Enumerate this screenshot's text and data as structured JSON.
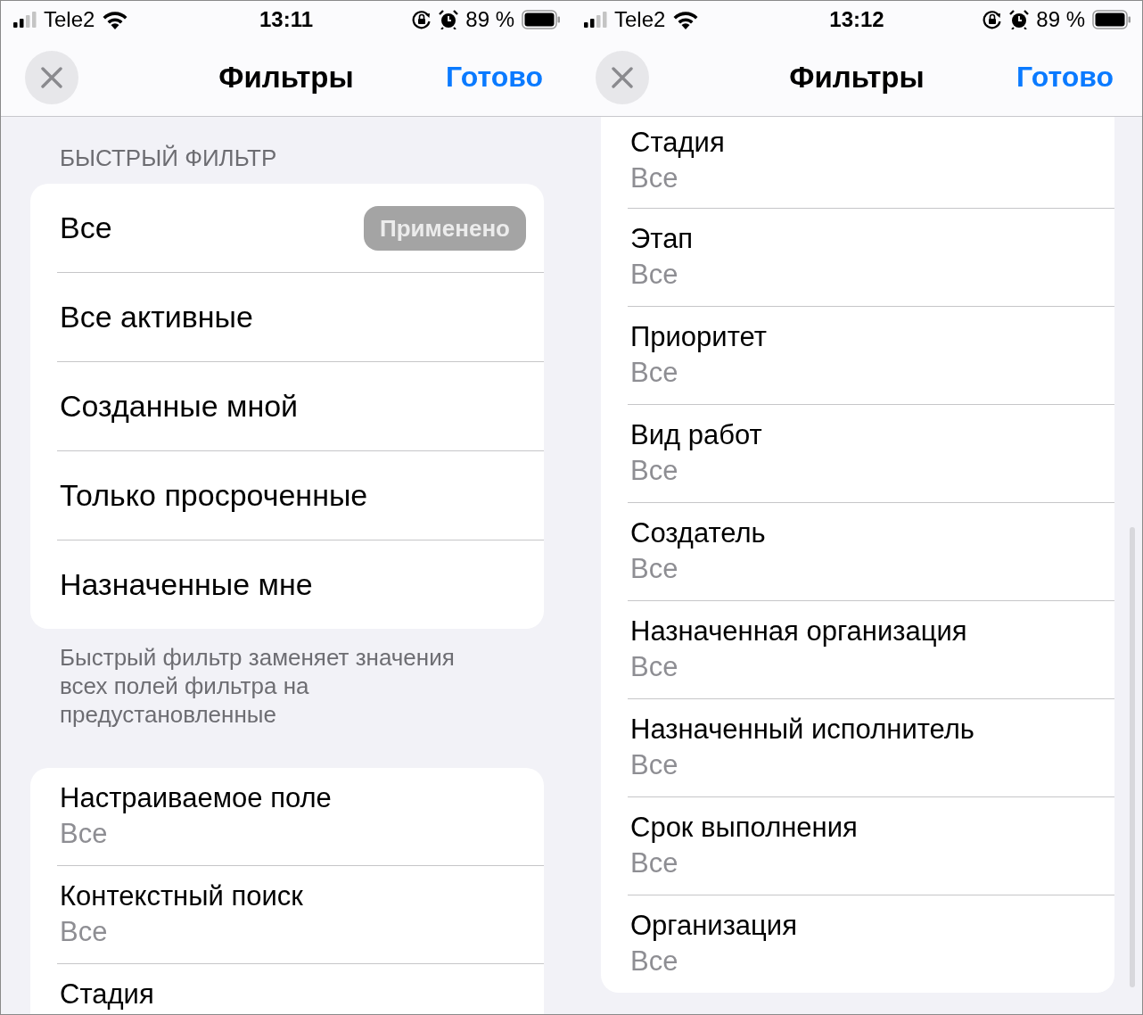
{
  "screens": [
    {
      "scrolled": false,
      "status_bar": {
        "carrier": "Tele2",
        "time": "13:11",
        "battery": "89 %"
      },
      "nav": {
        "title": "Фильтры",
        "done": "Готово"
      },
      "sections": [
        {
          "kind": "quick",
          "header": "БЫСТРЫЙ ФИЛЬТР",
          "items": [
            {
              "label": "Все",
              "badge": "Применено"
            },
            {
              "label": "Все активные"
            },
            {
              "label": "Созданные мной"
            },
            {
              "label": "Только просроченные"
            },
            {
              "label": "Назначенные мне"
            }
          ],
          "footer": "Быстрый фильтр заменяет значения всех полей фильтра на предустановленные"
        },
        {
          "kind": "fields",
          "items": [
            {
              "label": "Настраиваемое поле",
              "value": "Все"
            },
            {
              "label": "Контекстный поиск",
              "value": "Все"
            },
            {
              "label": "Стадия"
            }
          ]
        }
      ]
    },
    {
      "scrolled": true,
      "status_bar": {
        "carrier": "Tele2",
        "time": "13:12",
        "battery": "89 %"
      },
      "nav": {
        "title": "Фильтры",
        "done": "Готово"
      },
      "sections": [
        {
          "kind": "fields",
          "items": [
            {
              "label": "Стадия",
              "value": "Все"
            },
            {
              "label": "Этап",
              "value": "Все"
            },
            {
              "label": "Приоритет",
              "value": "Все"
            },
            {
              "label": "Вид работ",
              "value": "Все"
            },
            {
              "label": "Создатель",
              "value": "Все"
            },
            {
              "label": "Назначенная организация",
              "value": "Все"
            },
            {
              "label": "Назначенный исполнитель",
              "value": "Все"
            },
            {
              "label": "Срок выполнения",
              "value": "Все"
            },
            {
              "label": "Организация",
              "value": "Все"
            }
          ]
        }
      ]
    }
  ]
}
